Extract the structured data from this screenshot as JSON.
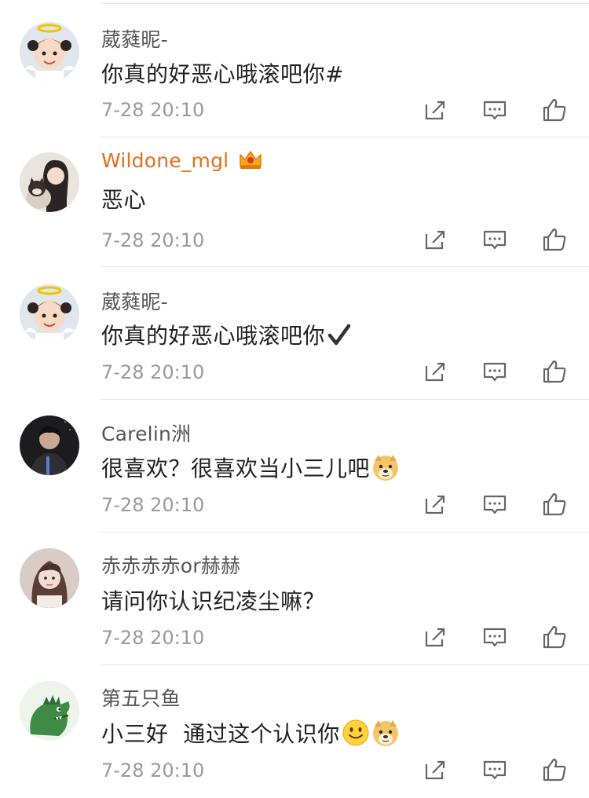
{
  "comments": [
    {
      "username": "葳蕤昵-",
      "vip": false,
      "text": "你真的好恶心哦滚吧你#",
      "suffix": "",
      "time": "7-28 20:10",
      "avatar": "girl-halo-avatar"
    },
    {
      "username": "Wildone_mgl",
      "vip": true,
      "text": "恶心",
      "suffix": "",
      "time": "7-28 20:10",
      "avatar": "girl-with-cat-avatar"
    },
    {
      "username": "葳蕤昵-",
      "vip": false,
      "text": "你真的好恶心哦滚吧你",
      "suffix": "checkmark",
      "time": "7-28 20:10",
      "avatar": "girl-halo-avatar"
    },
    {
      "username": "Carelin洲",
      "vip": false,
      "text": "很喜欢？很喜欢当小三儿吧",
      "suffix": "doge",
      "time": "7-28 20:10",
      "avatar": "man-dark-avatar"
    },
    {
      "username": "赤赤赤赤or赫赫",
      "vip": false,
      "text": "请问你认识纪凌尘嘛？",
      "suffix": "",
      "time": "7-28 20:10",
      "avatar": "girl-portrait-avatar"
    },
    {
      "username": "第五只鱼",
      "vip": false,
      "text": "小三好  通过这个认识你",
      "suffix": "smile-doge",
      "time": "7-28 20:10",
      "avatar": "green-dinosaur-avatar"
    }
  ],
  "icons": {
    "share": "share-icon",
    "comment": "comment-icon",
    "like": "thumbs-up-icon",
    "vip": "crown-vip-icon"
  },
  "colors": {
    "vip_name": "#e3701e",
    "name": "#555555",
    "text": "#222222",
    "time": "#9a9a9a",
    "icon": "#666666"
  }
}
